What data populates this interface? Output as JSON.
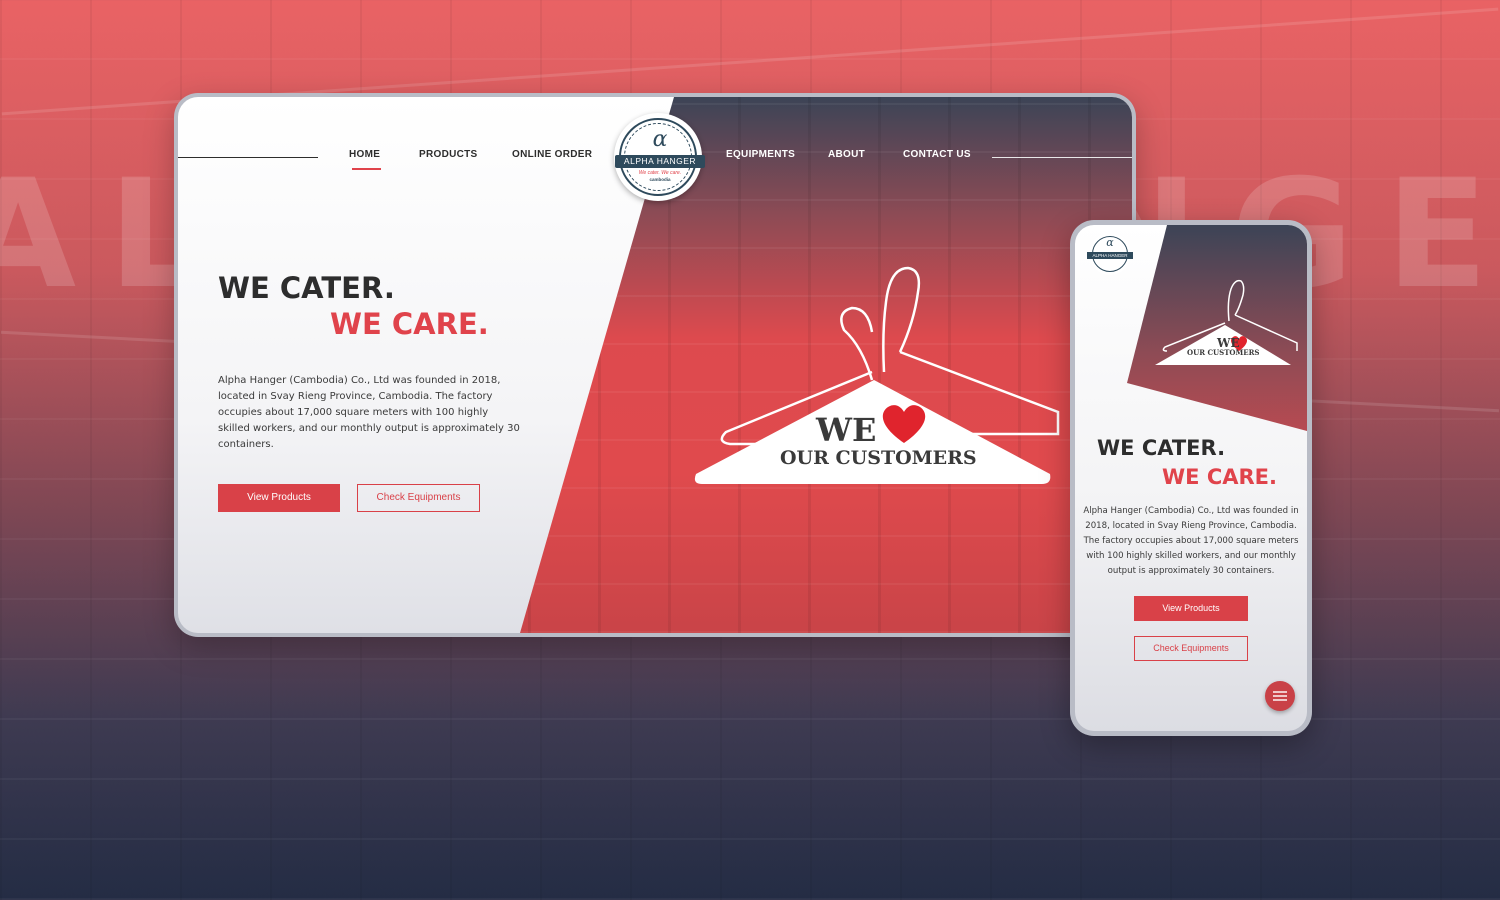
{
  "background": {
    "big_word": "ALPHA HANGER"
  },
  "desktop": {
    "nav": {
      "items": [
        "HOME",
        "PRODUCTS",
        "ONLINE ORDER",
        "EQUIPMENTS",
        "ABOUT",
        "CONTACT US"
      ],
      "active": "HOME"
    },
    "logo": {
      "alpha": "α",
      "name": "ALPHA HANGER",
      "tagline": "We cater. We care.",
      "sub": "cambodia"
    },
    "hero": {
      "line1": "WE CATER.",
      "line2": "WE CARE.",
      "description": "Alpha Hanger (Cambodia) Co., Ltd was founded in 2018, located in Svay Rieng Province, Cambodia. The factory occupies about 17,000 square meters with 100 highly skilled workers, and our monthly output is approximately 30 containers.",
      "btn_primary": "View Products",
      "btn_secondary": "Check Equipments"
    },
    "hanger": {
      "text1": "WE",
      "text2": "OUR CUSTOMERS"
    }
  },
  "mobile": {
    "logo": {
      "alpha": "α",
      "name": "ALPHA HANGER"
    },
    "hanger": {
      "text1": "WE",
      "text2": "OUR CUSTOMERS"
    },
    "hero": {
      "line1": "WE CATER.",
      "line2": "WE CARE.",
      "description": "Alpha Hanger (Cambodia) Co., Ltd was founded in 2018, located in Svay Rieng Province, Cambodia. The factory occupies about 17,000 square meters with 100 highly skilled workers, and our monthly output is approximately 30 containers.",
      "btn_primary": "View Products",
      "btn_secondary": "Check Equipments"
    }
  },
  "colors": {
    "brand_red": "#d94148",
    "brand_navy": "#2e4a5c",
    "text_dark": "#2d2d2d"
  }
}
